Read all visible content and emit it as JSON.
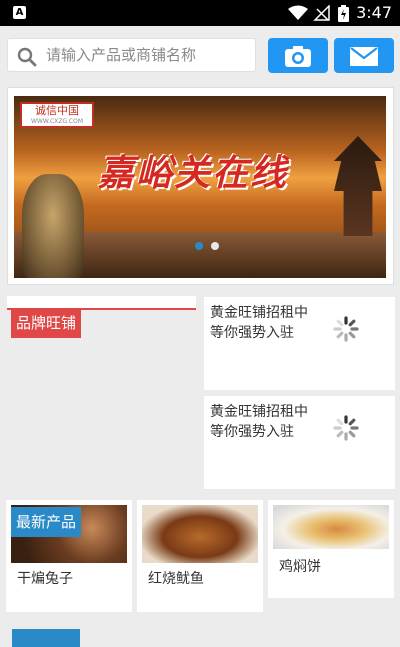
{
  "status_bar": {
    "time": "3:47",
    "app_badge": "A"
  },
  "search": {
    "placeholder": "请输入产品或商铺名称"
  },
  "header_buttons": [
    {
      "icon": "camera-icon"
    },
    {
      "icon": "mail-icon"
    }
  ],
  "banner": {
    "logo_text": "诚信中国",
    "logo_url_text": "WWW.CXZG.COM",
    "title": "嘉峪关在线",
    "dots": [
      {
        "active": true
      },
      {
        "active": false
      }
    ]
  },
  "brand_section": {
    "label": "品牌旺铺",
    "shops": [
      {
        "line1": "黄金旺铺招租中",
        "line2": "等你强势入驻"
      },
      {
        "line1": "黄金旺铺招租中",
        "line2": "等你强势入驻"
      }
    ]
  },
  "products_section": {
    "label": "最新产品",
    "items": [
      {
        "name": "干煸兔子"
      },
      {
        "name": "红烧鱿鱼"
      },
      {
        "name": "鸡焖饼"
      }
    ]
  },
  "colors": {
    "accent_blue": "#2196f3",
    "brand_red": "#e04848",
    "product_blue": "#2a8ac8"
  }
}
